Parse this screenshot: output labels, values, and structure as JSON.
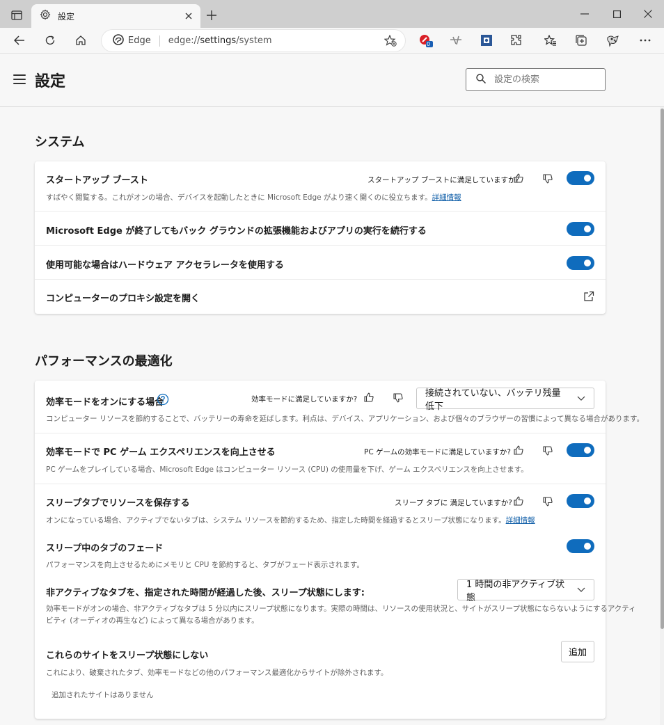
{
  "window": {
    "tab_title": "設定"
  },
  "toolbar": {
    "site_label": "Edge",
    "url_prefix": "edge://",
    "url_host": "settings",
    "url_path": "/system",
    "extension_badge": "0"
  },
  "header": {
    "title": "設定",
    "search_placeholder": "設定の検索"
  },
  "system": {
    "section_title": "システム",
    "startup_boost": {
      "title": "スタートアップ ブースト",
      "feedback": "スタートアップ ブーストに満足していますか?",
      "desc": "すばやく閲覧する。これがオンの場合、デバイスを起動したときに Microsoft Edge がより速く開くのに役立ちます。",
      "link": "詳細情報",
      "enabled": true
    },
    "background": {
      "title": "Microsoft Edge が終了してもバック グラウンドの拡張機能およびアプリの実行を続行する",
      "enabled": true
    },
    "hardware_accel": {
      "title": "使用可能な場合はハードウェア アクセラレータを使用する",
      "enabled": true
    },
    "proxy": {
      "title": "コンピューターのプロキシ設定を開く"
    }
  },
  "performance": {
    "section_title": "パフォーマンスの最適化",
    "efficiency_mode": {
      "title": "効率モードをオンにする場合",
      "feedback": "効率モードに満足していますか?",
      "dropdown": "接続されていない、バッテリ残量低下",
      "desc": "コンピューター リソースを節約することで、バッテリーの寿命を延ばします。利点は、デバイス、アプリケーション、および個々のブラウザーの習慣によって異なる場合があります。"
    },
    "pc_gaming": {
      "title": "効率モードで PC ゲーム エクスペリエンスを向上させる",
      "feedback": "PC ゲームの効率モードに満足していますか?",
      "desc": "PC ゲームをプレイしている場合、Microsoft Edge はコンピューター リソース (CPU) の使用量を下げ、ゲーム エクスペリエンスを向上させます。",
      "enabled": true
    },
    "sleeping_tabs": {
      "title": "スリープタブでリソースを保存する",
      "feedback": "スリープ タブに 満足していますか?",
      "desc": "オンになっている場合、アクティブでないタブは、システム リソースを節約するため、指定した時間を経過するとスリープ状態になります。",
      "link": "詳細情報",
      "enabled": true
    },
    "fade_tabs": {
      "title": "スリープ中のタブのフェード",
      "desc": "パフォーマンスを向上させるためにメモリと CPU を節約すると、タブがフェード表示されます。",
      "enabled": true
    },
    "inactive_tabs": {
      "title": "非アクティブなタブを、指定された時間が経過した後、スリープ状態にします:",
      "dropdown": "1 時間の非アクティブ状態",
      "desc_line1": "効率モードがオンの場合、非アクティブなタブは 5 分以内にスリープ状態になります。実際の時間は、リソースの使用状況と、サイトがスリープ状態にならないようにするアクティ",
      "desc_line2": "ビティ (オーディオの再生など) によって異なる場合があります。"
    },
    "never_sleep": {
      "title": "これらのサイトをスリープ状態にしない",
      "desc": "これにより、破棄されたタブ、効率モードなどの他のパフォーマンス最適化からサイトが除外されます。",
      "add_button": "追加",
      "empty": "追加されたサイトはありません"
    }
  },
  "colors": {
    "accent": "#0f6cbd",
    "link": "#0f5ea8"
  }
}
